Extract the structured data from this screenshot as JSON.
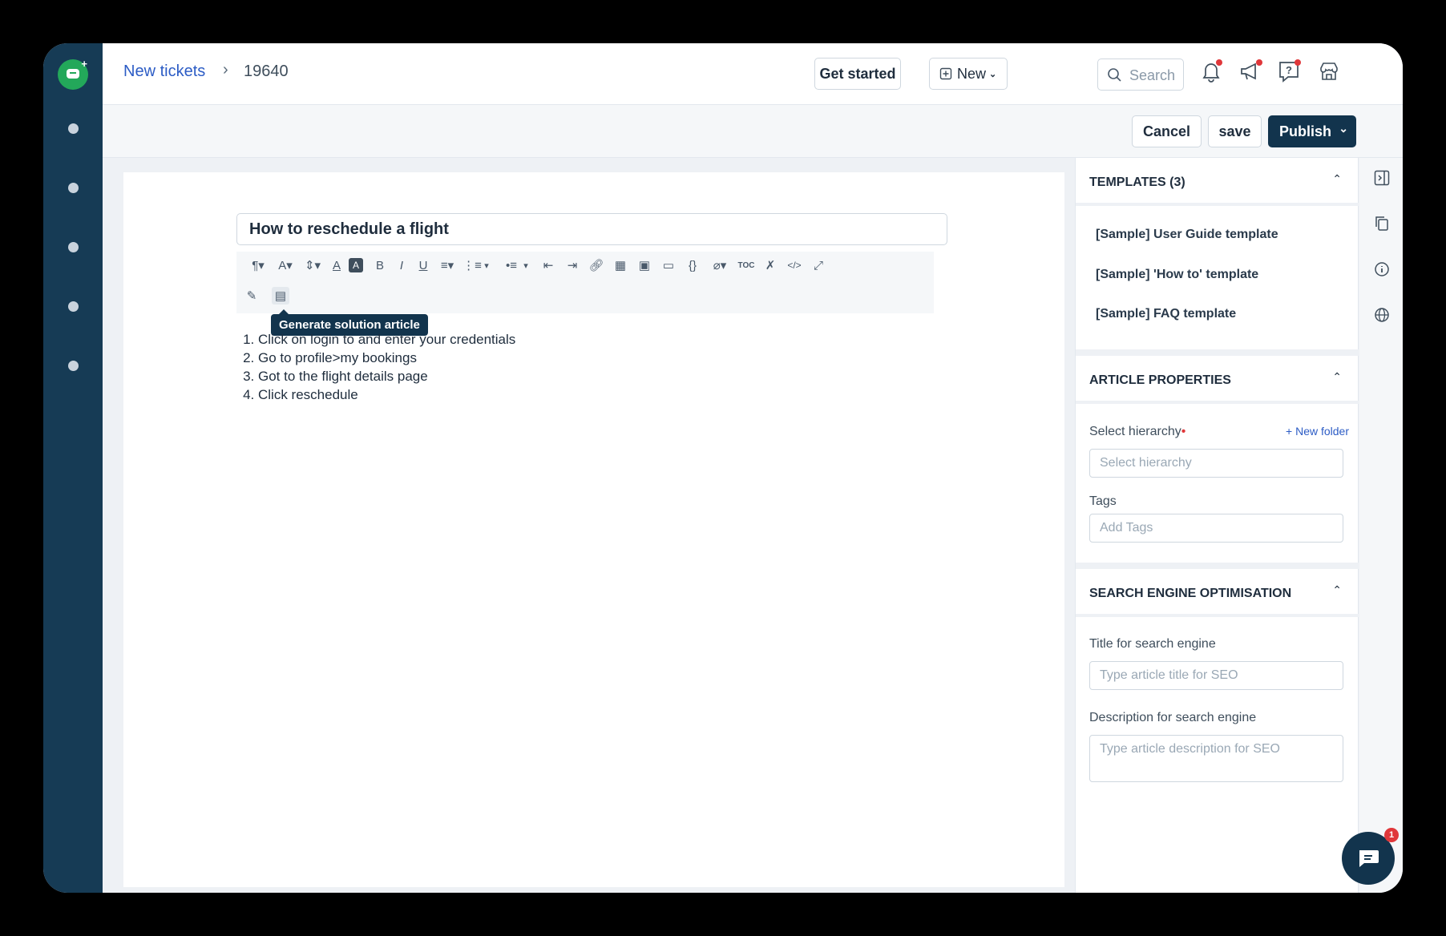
{
  "breadcrumb": {
    "parent": "New tickets",
    "separator": "›",
    "current": "19640"
  },
  "header": {
    "get_started": "Get started",
    "new_label": "New",
    "search_placeholder": "Search",
    "icons": [
      "bell-icon",
      "megaphone-icon",
      "help-icon",
      "marketplace-icon",
      "avatar"
    ]
  },
  "actions": {
    "cancel": "Cancel",
    "save": "save",
    "publish": "Publish"
  },
  "editor": {
    "title": "How to reschedule a flight",
    "tooltip": "Generate solution article",
    "steps": [
      "Click on login to and enter your credentials",
      "Go to profile>my bookings",
      "Got to the flight details page",
      "Click reschedule"
    ]
  },
  "panel": {
    "templates": {
      "heading": "TEMPLATES (3)",
      "items": [
        "[Sample] User Guide template",
        "[Sample] 'How to' template",
        "[Sample] FAQ template"
      ]
    },
    "properties": {
      "heading": "ARTICLE PROPERTIES",
      "hierarchy_label": "Select hierarchy",
      "required_mark": "•",
      "new_folder": "+ New folder",
      "hierarchy_placeholder": "Select hierarchy",
      "tags_label": "Tags",
      "tags_placeholder": "Add Tags"
    },
    "seo": {
      "heading": "SEARCH ENGINE OPTIMISATION",
      "title_label": "Title for search engine",
      "title_placeholder": "Type article title for SEO",
      "desc_label": "Description for search engine",
      "desc_placeholder": "Type article description for SEO"
    }
  },
  "chat": {
    "badge": "1"
  },
  "colors": {
    "rail": "#163b55",
    "primary": "#12344d",
    "link": "#2c5cc5",
    "alert": "#e0373a",
    "logo": "#23a85a"
  }
}
